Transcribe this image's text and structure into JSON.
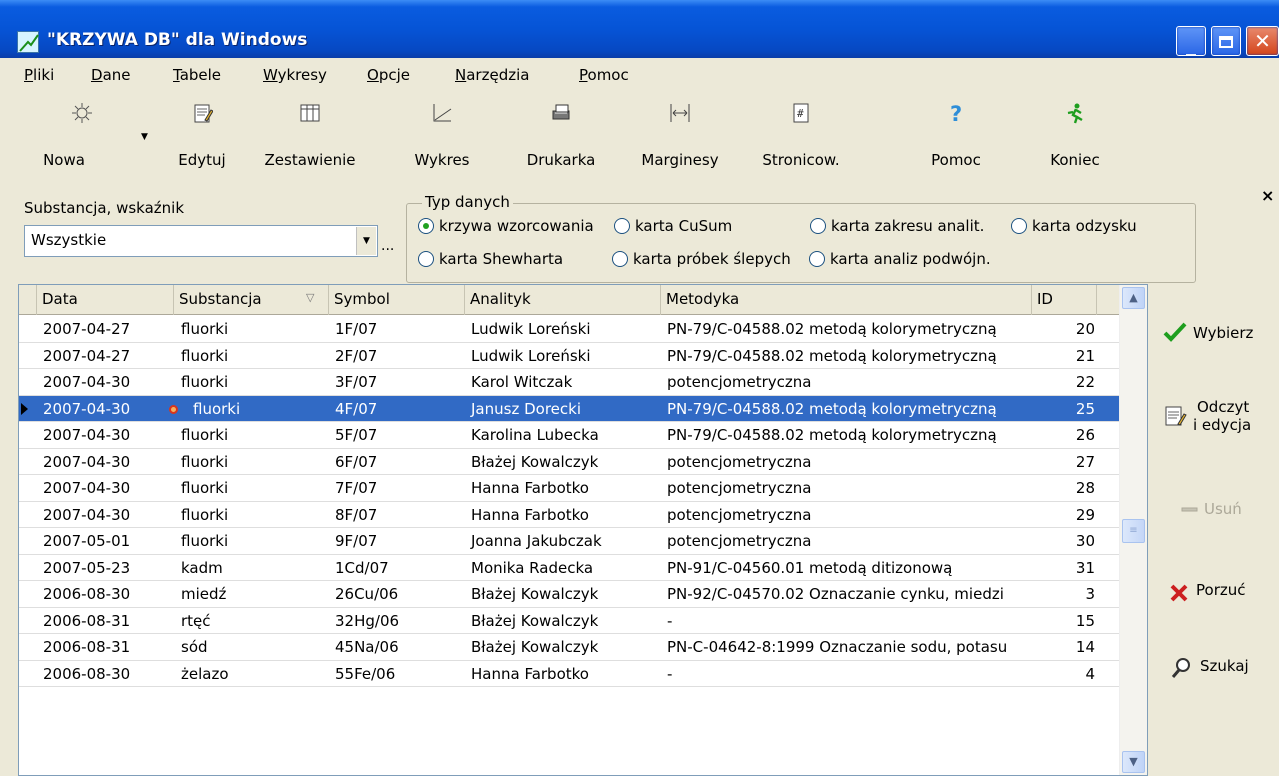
{
  "window": {
    "title": "\"KRZYWA DB\" dla Windows"
  },
  "menu": [
    "Pliki",
    "Dane",
    "Tabele",
    "Wykresy",
    "Opcje",
    "Narzędzia",
    "Pomoc"
  ],
  "toolbar": {
    "nowa": "Nowa",
    "edytuj": "Edytuj",
    "zestawienie": "Zestawienie",
    "wykres": "Wykres",
    "drukarka": "Drukarka",
    "marginesy": "Marginesy",
    "stronicow": "Stronicow.",
    "pomoc": "Pomoc",
    "koniec": "Koniec"
  },
  "filter": {
    "close_glyph": "×",
    "substance_label": "Substancja, wskaźnik",
    "substance_value": "Wszystkie",
    "ellipsis": "...",
    "type_legend": "Typ danych",
    "types": {
      "krzywa": "krzywa wzorcowania",
      "cusum": "karta CuSum",
      "zakres": "karta zakresu analit.",
      "odzysk": "karta odzysku",
      "shewhart": "karta Shewharta",
      "slepe": "karta próbek ślepych",
      "podwojne": "karta analiz podwójn."
    },
    "selected_type": "krzywa"
  },
  "table": {
    "columns": [
      "Data",
      "Substancja",
      "Symbol",
      "Analityk",
      "Metodyka",
      "ID"
    ],
    "sort_glyph": "▽",
    "rows": [
      {
        "data": "2007-04-27",
        "substancja": "fluorki",
        "symbol": "1F/07",
        "analityk": "Ludwik Loreński",
        "metodyka": " PN-79/C-04588.02 metodą kolorymetryczną",
        "id": "20"
      },
      {
        "data": "2007-04-27",
        "substancja": "fluorki",
        "symbol": "2F/07",
        "analityk": "Ludwik Loreński",
        "metodyka": " PN-79/C-04588.02 metodą kolorymetryczną",
        "id": "21"
      },
      {
        "data": "2007-04-30",
        "substancja": "fluorki",
        "symbol": "3F/07",
        "analityk": "Karol Witczak",
        "metodyka": "potencjometryczna",
        "id": "22"
      },
      {
        "data": "2007-04-30",
        "substancja": "fluorki",
        "symbol": "4F/07",
        "analityk": "Janusz Dorecki",
        "metodyka": " PN-79/C-04588.02 metodą kolorymetryczną",
        "id": "25"
      },
      {
        "data": "2007-04-30",
        "substancja": "fluorki",
        "symbol": "5F/07",
        "analityk": "Karolina Lubecka",
        "metodyka": " PN-79/C-04588.02 metodą kolorymetryczną",
        "id": "26"
      },
      {
        "data": "2007-04-30",
        "substancja": "fluorki",
        "symbol": "6F/07",
        "analityk": "Błażej Kowalczyk",
        "metodyka": "potencjometryczna",
        "id": "27"
      },
      {
        "data": "2007-04-30",
        "substancja": "fluorki",
        "symbol": "7F/07",
        "analityk": "Hanna Farbotko",
        "metodyka": "potencjometryczna",
        "id": "28"
      },
      {
        "data": "2007-04-30",
        "substancja": "fluorki",
        "symbol": "8F/07",
        "analityk": "Hanna Farbotko",
        "metodyka": "potencjometryczna",
        "id": "29"
      },
      {
        "data": "2007-05-01",
        "substancja": "fluorki",
        "symbol": "9F/07",
        "analityk": "Joanna Jakubczak",
        "metodyka": "potencjometryczna",
        "id": "30"
      },
      {
        "data": "2007-05-23",
        "substancja": "kadm",
        "symbol": "1Cd/07",
        "analityk": "Monika Radecka",
        "metodyka": "PN-91/C-04560.01 metodą ditizonową",
        "id": "31"
      },
      {
        "data": "2006-08-30",
        "substancja": "miedź",
        "symbol": "26Cu/06",
        "analityk": "Błażej Kowalczyk",
        "metodyka": "PN-92/C-04570.02 Oznaczanie cynku, miedzi",
        "id": "3"
      },
      {
        "data": "2006-08-31",
        "substancja": "rtęć",
        "symbol": "32Hg/06",
        "analityk": "Błażej Kowalczyk",
        "metodyka": "-",
        "id": "15"
      },
      {
        "data": "2006-08-31",
        "substancja": "sód",
        "symbol": "45Na/06",
        "analityk": "Błażej Kowalczyk",
        "metodyka": "PN-C-04642-8:1999 Oznaczanie sodu, potasu",
        "id": "14"
      },
      {
        "data": "2006-08-30",
        "substancja": "żelazo",
        "symbol": "55Fe/06",
        "analityk": "Hanna Farbotko",
        "metodyka": "-",
        "id": "4"
      }
    ]
  },
  "side": {
    "wybierz": "Wybierz",
    "odczyt_line1": "Odczyt",
    "odczyt_line2": "i edycja",
    "usun": "Usuń",
    "porzuc": "Porzuć",
    "szukaj": "Szukaj"
  },
  "colors": {
    "selection": "#316ac5",
    "titlebar": "#0654d6",
    "radio_dot": "#21a121"
  }
}
